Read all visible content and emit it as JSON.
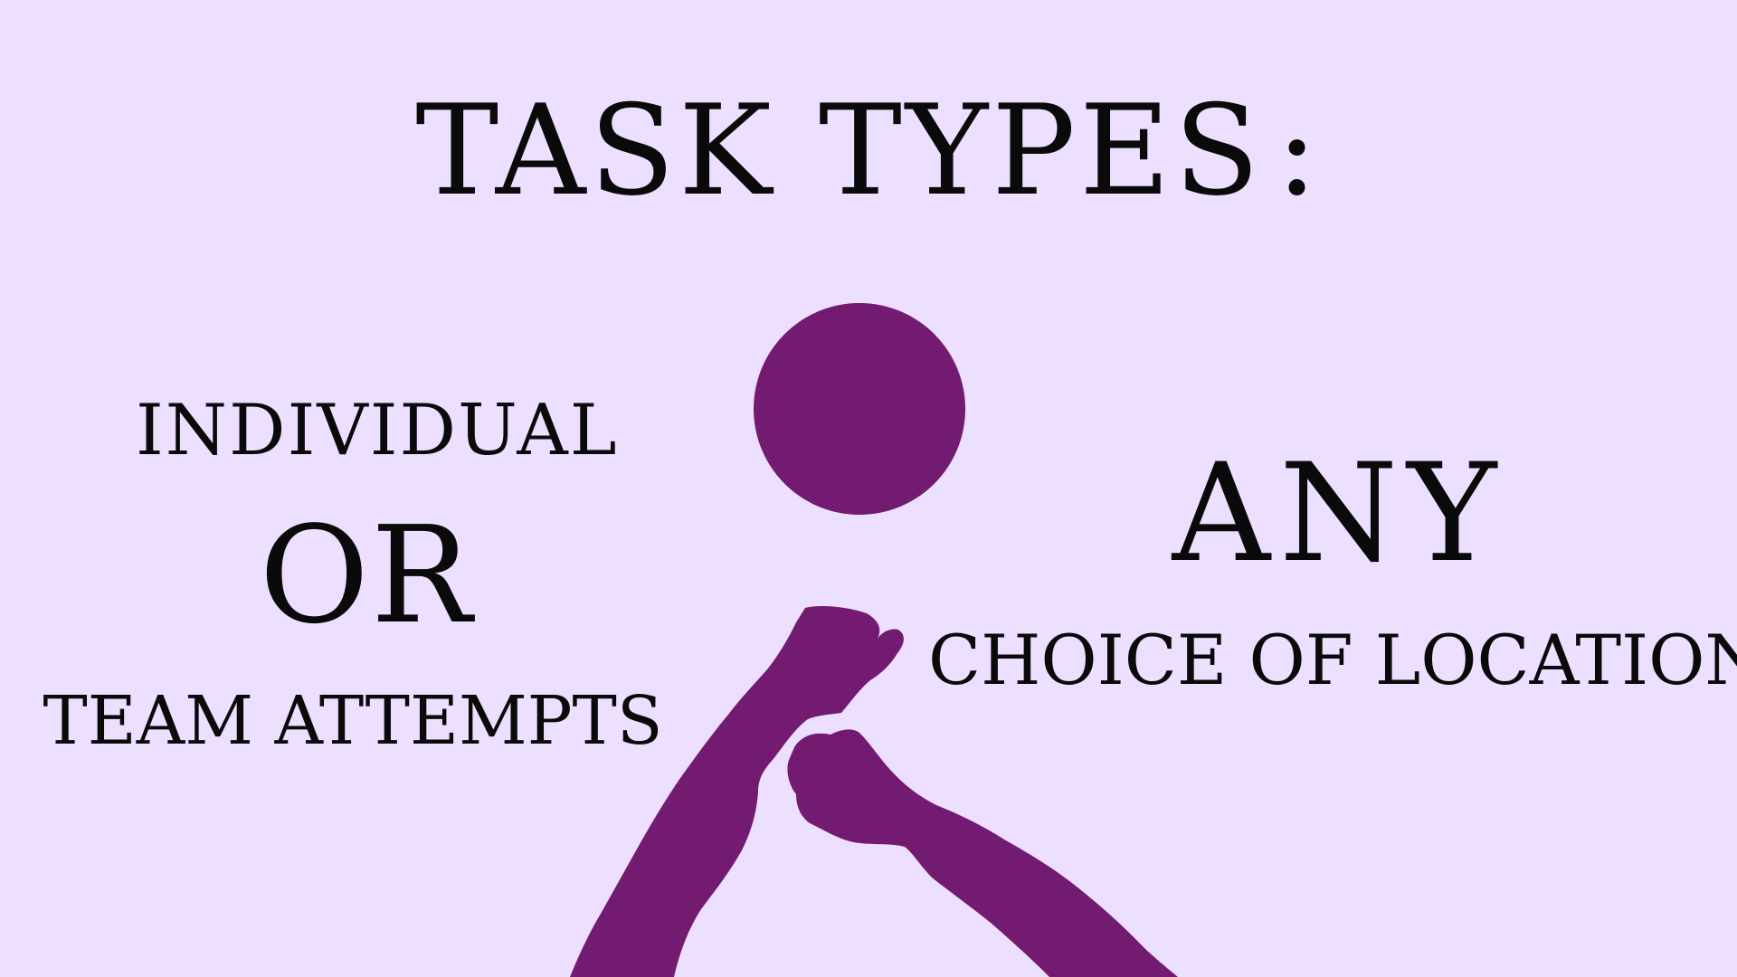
{
  "slide": {
    "title": "TASK TYPES",
    "title_colon": ":",
    "left": {
      "line1": "INDIVIDUAL",
      "line2": "OR",
      "line3": "TEAM ATTEMPTS"
    },
    "right": {
      "line1": "ANY",
      "line2": "CHOICE OF LOCATION"
    }
  },
  "colors": {
    "background": "#ecdfff",
    "figure": "#731b70",
    "text": "#0a0a0a"
  },
  "icons": {
    "figure": "person-raising-fists-icon"
  }
}
